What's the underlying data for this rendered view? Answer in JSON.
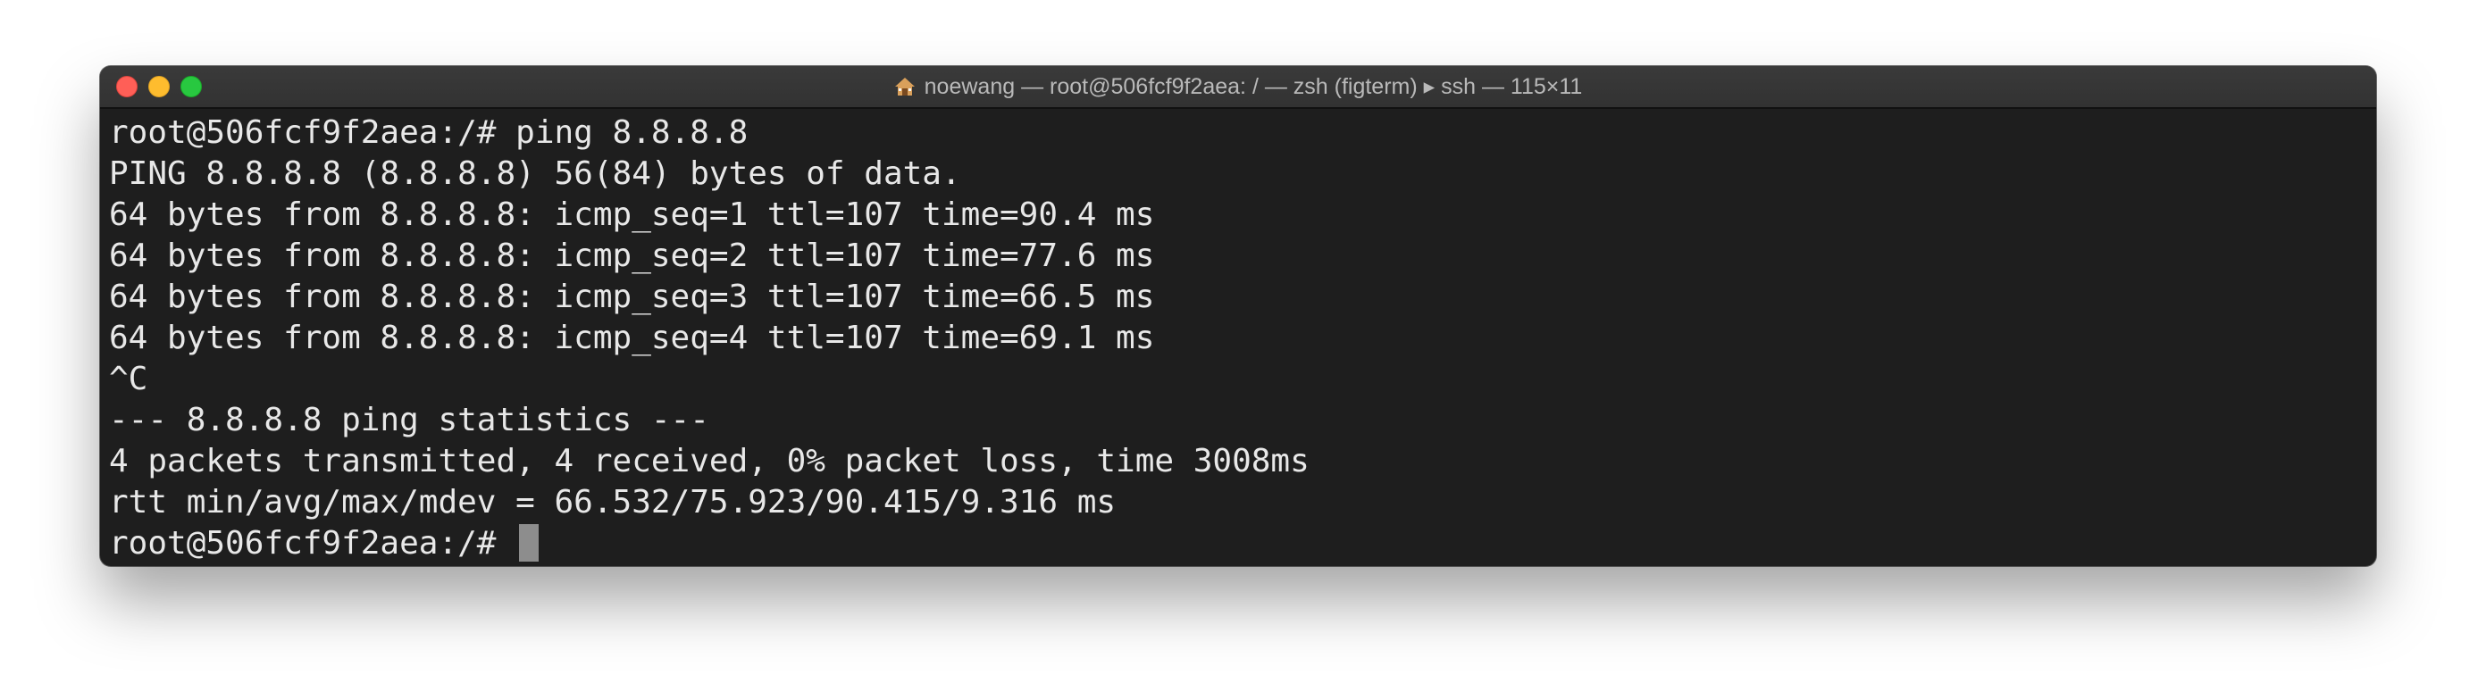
{
  "window": {
    "title": "noewang — root@506fcf9f2aea: / — zsh (figterm) ▸ ssh — 115×11"
  },
  "terminal": {
    "lines": [
      "root@506fcf9f2aea:/# ping 8.8.8.8",
      "PING 8.8.8.8 (8.8.8.8) 56(84) bytes of data.",
      "64 bytes from 8.8.8.8: icmp_seq=1 ttl=107 time=90.4 ms",
      "64 bytes from 8.8.8.8: icmp_seq=2 ttl=107 time=77.6 ms",
      "64 bytes from 8.8.8.8: icmp_seq=3 ttl=107 time=66.5 ms",
      "64 bytes from 8.8.8.8: icmp_seq=4 ttl=107 time=69.1 ms",
      "^C",
      "--- 8.8.8.8 ping statistics ---",
      "4 packets transmitted, 4 received, 0% packet loss, time 3008ms",
      "rtt min/avg/max/mdev = 66.532/75.923/90.415/9.316 ms"
    ],
    "prompt": "root@506fcf9f2aea:/# "
  },
  "colors": {
    "background": "#1e1e1e",
    "text": "#e8e8e8",
    "cursor": "#8d8d8d"
  },
  "icons": {
    "title": "home-icon"
  }
}
